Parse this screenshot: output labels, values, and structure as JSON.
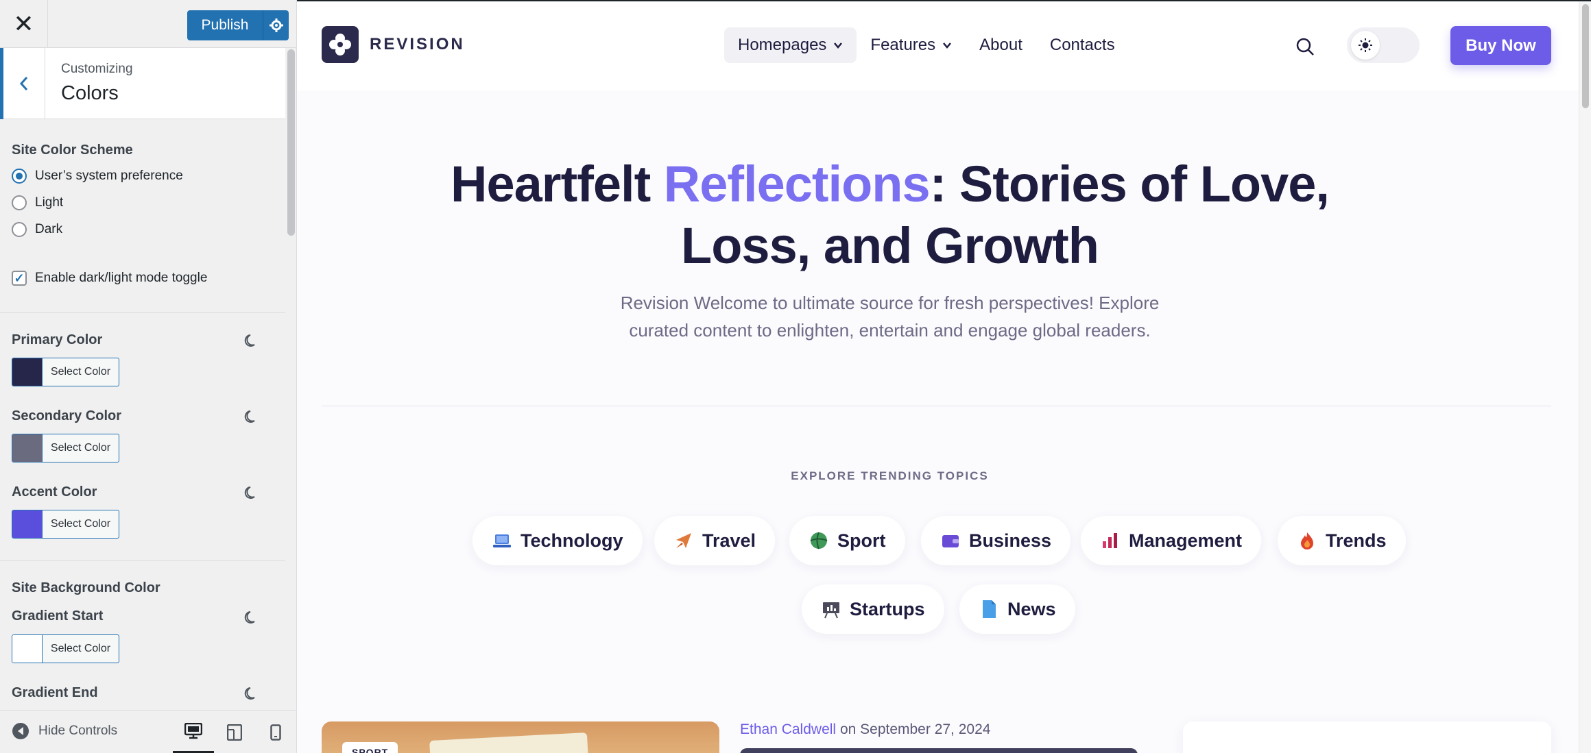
{
  "customizer": {
    "close_glyph": "✕",
    "publish_label": "Publish",
    "customizing_label": "Customizing",
    "section_title": "Colors",
    "color_scheme": {
      "label": "Site Color Scheme",
      "options": [
        "User’s system preference",
        "Light",
        "Dark"
      ],
      "selected": "User’s system preference"
    },
    "toggle": {
      "label": "Enable dark/light mode toggle",
      "checked": true
    },
    "colors": [
      {
        "label": "Primary Color",
        "button": "Select Color",
        "swatch": "#26254a"
      },
      {
        "label": "Secondary Color",
        "button": "Select Color",
        "swatch": "#6b6b80"
      },
      {
        "label": "Accent Color",
        "button": "Select Color",
        "swatch": "#5a4fdc"
      }
    ],
    "background": {
      "label": "Site Background Color",
      "gradient_start": {
        "label": "Gradient Start",
        "button": "Select Color",
        "swatch": "#ffffff"
      },
      "gradient_end": {
        "label": "Gradient End"
      }
    },
    "footer": {
      "hide_controls": "Hide Controls",
      "active_device": "desktop"
    }
  },
  "site": {
    "logo_text": "REVISION",
    "nav": [
      {
        "label": "Homepages",
        "dropdown": true,
        "active": true
      },
      {
        "label": "Features",
        "dropdown": true,
        "active": false
      },
      {
        "label": "About",
        "dropdown": false,
        "active": false
      },
      {
        "label": "Contacts",
        "dropdown": false,
        "active": false
      }
    ],
    "buy_label": "Buy Now",
    "hero": {
      "title_before": "Heartfelt ",
      "title_accent": "Reflections",
      "title_after": ": Stories of Love, Loss, and Growth",
      "subtitle": "Revision Welcome to ultimate source for fresh perspectives! Explore curated content to enlighten, entertain and engage global readers."
    },
    "topics_label": "EXPLORE TRENDING TOPICS",
    "topics": [
      {
        "label": "Technology",
        "icon": "laptop-icon"
      },
      {
        "label": "Travel",
        "icon": "plane-icon"
      },
      {
        "label": "Sport",
        "icon": "ball-icon"
      },
      {
        "label": "Business",
        "icon": "wallet-icon"
      },
      {
        "label": "Management",
        "icon": "bar-chart-icon"
      },
      {
        "label": "Trends",
        "icon": "flame-icon"
      },
      {
        "label": "Startups",
        "icon": "presentation-icon"
      },
      {
        "label": "News",
        "icon": "document-icon"
      }
    ],
    "post": {
      "badge": "SPORT",
      "author": "Ethan Caldwell",
      "date_text": "on September 27, 2024"
    },
    "accent_color": "#6c5ce7",
    "primary_text_color": "#1f1d3f"
  }
}
